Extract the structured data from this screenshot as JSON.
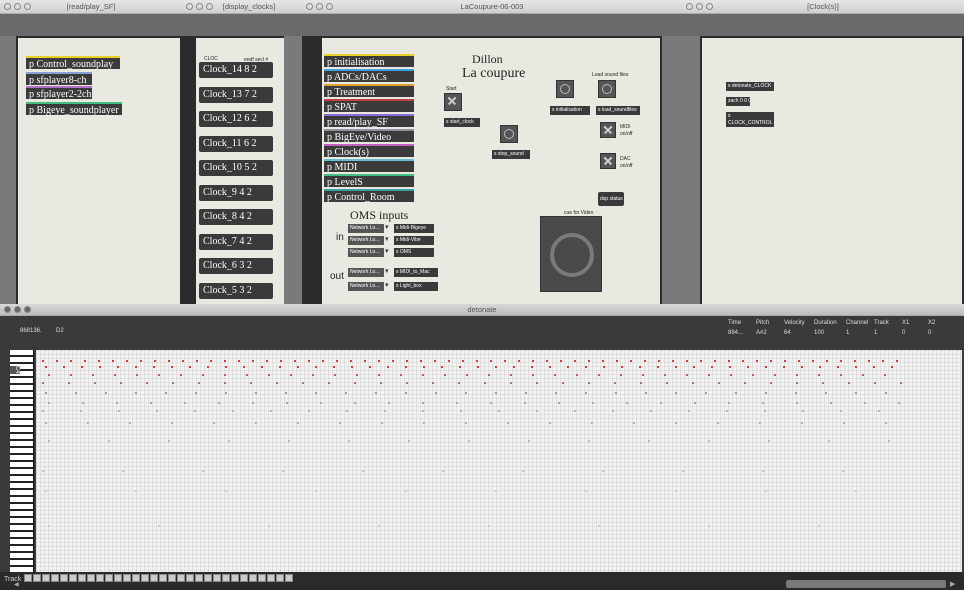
{
  "windows": {
    "readplay": {
      "title": "[read/play_SF]",
      "objects": [
        {
          "label": "p Control_soundplay",
          "color": "#e8d22a"
        },
        {
          "label": "p sfplayer8-ch",
          "color": "#8aa0d8"
        },
        {
          "label": "p sfplayer2-2ch",
          "color": "#b070c8"
        },
        {
          "label": "p Bigeye_soundplayer",
          "color": "#40c080"
        }
      ]
    },
    "display_clocks": {
      "title": "[display_clocks]",
      "header_left": "CLOC",
      "header_right": "endf secl #",
      "clocks": [
        "Clock_14 8 2",
        "Clock_13 7 2",
        "Clock_12 6 2",
        "Clock_11 6 2",
        "Clock_10 5 2",
        "Clock_9 4 2",
        "Clock_8 4 2",
        "Clock_7 4 2",
        "Clock_6 3 2",
        "Clock_5 3 2"
      ]
    },
    "lacoupure": {
      "title": "LaCoupure-06-003",
      "heading1": "Dillon",
      "heading2": "La coupure",
      "subpatchers": [
        {
          "label": "p initialisation",
          "color": "#e8d22a"
        },
        {
          "label": "p ADCs/DACs",
          "color": "#40a0e0"
        },
        {
          "label": "p Treatment",
          "color": "#e0a030"
        },
        {
          "label": "p SPAT",
          "color": "#c04040"
        },
        {
          "label": "p read/play_SF",
          "color": "#8a6ad8"
        },
        {
          "label": "p BigEye/Video",
          "color": "#9090a0"
        },
        {
          "label": "p Clock(s)",
          "color": "#c060c0"
        },
        {
          "label": "p MIDI",
          "color": "#60c0d0"
        },
        {
          "label": "p LevelS",
          "color": "#40c080"
        },
        {
          "label": "p Control_Room",
          "color": "#3aa0a0"
        }
      ],
      "start_label": "Start",
      "start_obj": "s start_clock",
      "stop_obj": "s stop_sound",
      "load_label": "Load sound files",
      "init_obj": "s initialisation",
      "loadsf_obj": "s load_soundfiles",
      "midi_label": "MIDI",
      "midi_state": "on/off",
      "dac_label": "DAC",
      "dac_state": "on/off",
      "dsp_label": "dsp status",
      "video_label": "cue for Video",
      "oms_title": "OMS inputs",
      "in_label": "in",
      "out_label": "out",
      "network_label": "Network Lo...",
      "in_sends": [
        "s Midi-Bigeye",
        "s Midi-Vibe",
        "s OMS"
      ],
      "out_sends": [
        "s MIDI_to_Mac",
        "s Light_box"
      ]
    },
    "clocks": {
      "title": "[Clock(s)]",
      "objs": [
        "s detonate_CLOCK",
        "zach 0 0 0",
        "s",
        "CLOCK_CONTROL"
      ]
    },
    "detonate": {
      "title": "detonate",
      "position": "868136.",
      "note": "D2",
      "headers": [
        "Time",
        "Pitch",
        "Velocity",
        "Duration",
        "Channel",
        "Track",
        "X1",
        "X2"
      ],
      "values": [
        "884...",
        "A#2",
        "64",
        "100",
        "1",
        "1",
        "0",
        "0"
      ],
      "keyboard_label": "C4",
      "track_label": "Track",
      "track_count": 30
    }
  },
  "colors": {
    "canvas": "#e9e9e1",
    "note": "#d04040",
    "note_light": "#b8a0a0"
  }
}
